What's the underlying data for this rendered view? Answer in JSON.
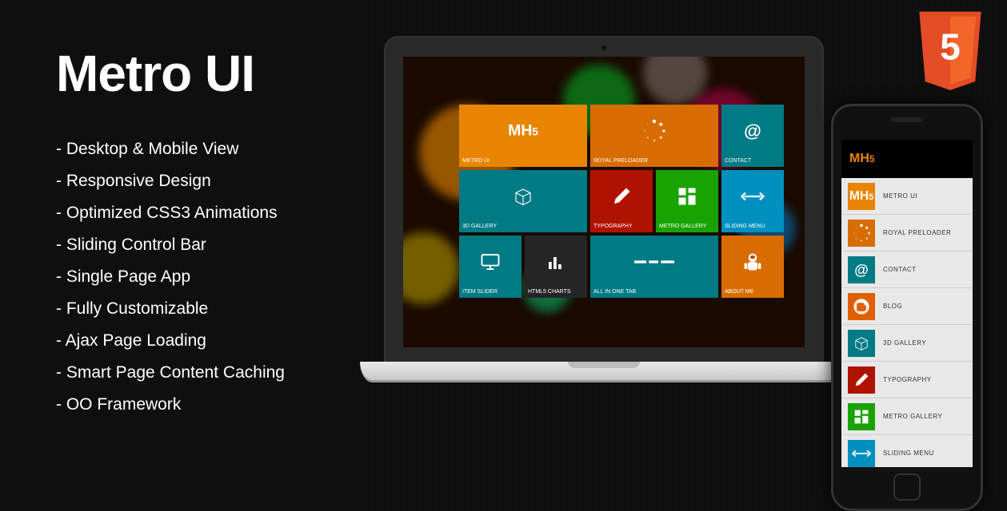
{
  "title": "Metro UI",
  "features": [
    "- Desktop & Mobile View",
    "- Responsive Design",
    "- Optimized CSS3 Animations",
    "- Sliding Control Bar",
    "- Single Page App",
    "- Fully Customizable",
    "- Ajax Page Loading",
    "- Smart Page Content Caching",
    "- OO Framework"
  ],
  "badge": {
    "label": "5"
  },
  "logo": {
    "prefix": "MH",
    "suffix": "5"
  },
  "tiles": [
    {
      "label": "METRO UI",
      "color": "c-orange",
      "w": 2,
      "icon": "mh5"
    },
    {
      "label": "ROYAL PRELOADER",
      "color": "c-darkorange",
      "w": 2,
      "icon": "loader"
    },
    {
      "label": "CONTACT",
      "color": "c-teal",
      "w": 1,
      "icon": "at"
    },
    {
      "label": "3D GALLERY",
      "color": "c-teal",
      "w": 2,
      "icon": "cube"
    },
    {
      "label": "TYPOGRAPHY",
      "color": "c-red",
      "w": 1,
      "icon": "pencil"
    },
    {
      "label": "METRO GALLERY",
      "color": "c-green",
      "w": 1,
      "icon": "grid"
    },
    {
      "label": "SLIDING MENU",
      "color": "c-blue",
      "w": 1,
      "icon": "arrows"
    },
    {
      "label": "ITEM SLIDER",
      "color": "c-teal",
      "w": 1,
      "icon": "monitor"
    },
    {
      "label": "HTML5 CHARTS",
      "color": "c-dark",
      "w": 1,
      "icon": "bars"
    },
    {
      "label": "ALL IN ONE TAB",
      "color": "c-teal",
      "w": 2,
      "icon": "lines"
    },
    {
      "label": "ABOUT ME",
      "color": "c-darkorange",
      "w": 1,
      "icon": "astronaut"
    }
  ],
  "mobile_items": [
    {
      "label": "METRO UI",
      "color": "c-orange",
      "icon": "mh5"
    },
    {
      "label": "ROYAL PRELOADER",
      "color": "c-darkorange",
      "icon": "loader"
    },
    {
      "label": "CONTACT",
      "color": "c-teal",
      "icon": "at"
    },
    {
      "label": "BLOG",
      "color": "c-blogger",
      "icon": "blogger"
    },
    {
      "label": "3D GALLERY",
      "color": "c-teal",
      "icon": "cube"
    },
    {
      "label": "TYPOGRAPHY",
      "color": "c-red",
      "icon": "pencil"
    },
    {
      "label": "METRO GALLERY",
      "color": "c-green",
      "icon": "grid"
    },
    {
      "label": "SLIDING MENU",
      "color": "c-blue",
      "icon": "arrows"
    }
  ]
}
